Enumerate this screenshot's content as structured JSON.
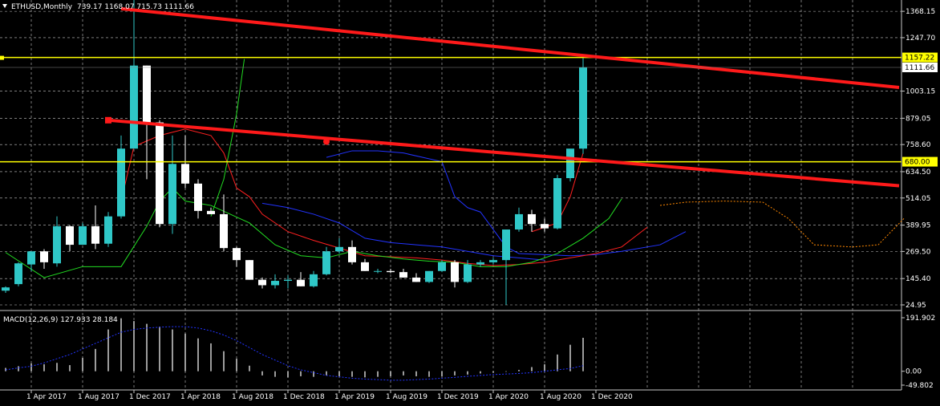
{
  "header": {
    "icon": "triangle-down-icon",
    "symbol_label": "ETHUSD,Monthly",
    "ohlc": "739.17 1168.07 715.73 1111.66"
  },
  "macd": {
    "label": "MACD(12,26,9) 127.933 28.184",
    "axis_labels": [
      "191.902",
      "0.00",
      "-49.802"
    ]
  },
  "colors": {
    "background": "#000000",
    "grid": "#c8c8c8",
    "bull_candle": "#2fc7c7",
    "bear_candle": "#ffffff",
    "trendline": "#ff1a1a",
    "level_line": "#ffff00",
    "ma_green": "#22dd22",
    "ma_red": "#ff2020",
    "ma_blue": "#2233ff",
    "forecast": "#ff8800"
  },
  "chart_data": {
    "type": "candlestick",
    "title": "ETHUSD,Monthly",
    "y_ticks": [
      "1368.15",
      "1247.70",
      "1003.15",
      "879.05",
      "758.60",
      "634.50",
      "514.05",
      "389.95",
      "269.50",
      "145.40",
      "24.95"
    ],
    "x_ticks": [
      "1 Apr 2017",
      "1 Aug 2017",
      "1 Dec 2017",
      "1 Apr 2018",
      "1 Aug 2018",
      "1 Dec 2018",
      "1 Apr 2019",
      "1 Aug 2019",
      "1 Dec 2019",
      "1 Apr 2020",
      "1 Aug 2020",
      "1 Dec 2020"
    ],
    "ylim": [
      24.95,
      1420
    ],
    "start_month": "Feb 2017",
    "candles": [
      {
        "o": 90,
        "h": 110,
        "l": 80,
        "c": 105
      },
      {
        "o": 120,
        "h": 220,
        "l": 110,
        "c": 215
      },
      {
        "o": 210,
        "h": 260,
        "l": 180,
        "c": 270
      },
      {
        "o": 270,
        "h": 280,
        "l": 190,
        "c": 220
      },
      {
        "o": 215,
        "h": 430,
        "l": 200,
        "c": 385
      },
      {
        "o": 385,
        "h": 390,
        "l": 270,
        "c": 300
      },
      {
        "o": 300,
        "h": 400,
        "l": 300,
        "c": 385
      },
      {
        "o": 385,
        "h": 480,
        "l": 280,
        "c": 305
      },
      {
        "o": 305,
        "h": 450,
        "l": 290,
        "c": 430
      },
      {
        "o": 430,
        "h": 800,
        "l": 420,
        "c": 740
      },
      {
        "o": 740,
        "h": 1420,
        "l": 740,
        "c": 1120
      },
      {
        "o": 1120,
        "h": 1120,
        "l": 600,
        "c": 860
      },
      {
        "o": 860,
        "h": 870,
        "l": 380,
        "c": 395
      },
      {
        "o": 395,
        "h": 800,
        "l": 350,
        "c": 670
      },
      {
        "o": 670,
        "h": 800,
        "l": 560,
        "c": 580
      },
      {
        "o": 580,
        "h": 600,
        "l": 420,
        "c": 455
      },
      {
        "o": 455,
        "h": 470,
        "l": 440,
        "c": 440
      },
      {
        "o": 440,
        "h": 530,
        "l": 270,
        "c": 285
      },
      {
        "o": 285,
        "h": 290,
        "l": 200,
        "c": 230
      },
      {
        "o": 230,
        "h": 230,
        "l": 140,
        "c": 140
      },
      {
        "o": 140,
        "h": 150,
        "l": 100,
        "c": 115
      },
      {
        "o": 115,
        "h": 165,
        "l": 100,
        "c": 135
      },
      {
        "o": 135,
        "h": 160,
        "l": 100,
        "c": 140
      },
      {
        "o": 140,
        "h": 175,
        "l": 110,
        "c": 110
      },
      {
        "o": 110,
        "h": 180,
        "l": 105,
        "c": 165
      },
      {
        "o": 165,
        "h": 290,
        "l": 160,
        "c": 270
      },
      {
        "o": 270,
        "h": 330,
        "l": 260,
        "c": 290
      },
      {
        "o": 290,
        "h": 320,
        "l": 210,
        "c": 220
      },
      {
        "o": 220,
        "h": 235,
        "l": 180,
        "c": 180
      },
      {
        "o": 180,
        "h": 190,
        "l": 170,
        "c": 180
      },
      {
        "o": 180,
        "h": 190,
        "l": 170,
        "c": 175
      },
      {
        "o": 175,
        "h": 190,
        "l": 150,
        "c": 150
      },
      {
        "o": 150,
        "h": 170,
        "l": 130,
        "c": 130
      },
      {
        "o": 130,
        "h": 180,
        "l": 125,
        "c": 180
      },
      {
        "o": 180,
        "h": 230,
        "l": 175,
        "c": 220
      },
      {
        "o": 220,
        "h": 230,
        "l": 105,
        "c": 130
      },
      {
        "o": 130,
        "h": 230,
        "l": 125,
        "c": 210
      },
      {
        "o": 210,
        "h": 230,
        "l": 200,
        "c": 220
      },
      {
        "o": 220,
        "h": 240,
        "l": 210,
        "c": 230
      },
      {
        "o": 230,
        "h": 360,
        "l": 25,
        "c": 370
      },
      {
        "o": 370,
        "h": 470,
        "l": 360,
        "c": 440
      },
      {
        "o": 440,
        "h": 460,
        "l": 360,
        "c": 395
      },
      {
        "o": 395,
        "h": 420,
        "l": 360,
        "c": 375
      },
      {
        "o": 375,
        "h": 620,
        "l": 370,
        "c": 605
      },
      {
        "o": 605,
        "h": 720,
        "l": 590,
        "c": 740
      },
      {
        "o": 740,
        "h": 1168,
        "l": 716,
        "c": 1112
      }
    ],
    "levels": [
      {
        "price": 1157.22,
        "label": "1157.22"
      },
      {
        "price": 680.0,
        "label": "680.00"
      }
    ],
    "last_price": {
      "price": 1111.66,
      "label": "1111.66"
    },
    "trendlines": [
      {
        "m1": 9,
        "p1": 1380,
        "m2": 70,
        "p2": 1020
      },
      {
        "m1": 8,
        "p1": 870,
        "m2": 70,
        "p2": 570
      }
    ],
    "ma_green": [
      [
        0,
        265
      ],
      [
        3,
        150
      ],
      [
        6,
        200
      ],
      [
        9,
        200
      ],
      [
        11,
        385
      ],
      [
        12,
        500
      ],
      [
        13,
        560
      ],
      [
        14,
        500
      ],
      [
        16,
        480
      ],
      [
        19,
        400
      ],
      [
        21,
        300
      ],
      [
        23,
        250
      ],
      [
        25,
        240
      ],
      [
        27,
        270
      ],
      [
        29,
        250
      ],
      [
        31,
        235
      ],
      [
        33,
        225
      ],
      [
        35,
        220
      ],
      [
        37,
        200
      ],
      [
        39,
        200
      ],
      [
        41,
        220
      ],
      [
        43,
        260
      ],
      [
        45,
        330
      ],
      [
        47,
        420
      ],
      [
        48,
        510
      ]
    ],
    "ma_red": [
      [
        9,
        500
      ],
      [
        10,
        750
      ],
      [
        12,
        800
      ],
      [
        14,
        830
      ],
      [
        16,
        800
      ],
      [
        17,
        720
      ],
      [
        18,
        560
      ],
      [
        19,
        520
      ],
      [
        20,
        440
      ],
      [
        22,
        360
      ],
      [
        24,
        320
      ],
      [
        26,
        285
      ],
      [
        28,
        250
      ],
      [
        30,
        245
      ],
      [
        32,
        240
      ],
      [
        34,
        230
      ],
      [
        36,
        215
      ],
      [
        38,
        205
      ],
      [
        40,
        210
      ],
      [
        42,
        220
      ],
      [
        44,
        240
      ],
      [
        46,
        260
      ],
      [
        48,
        290
      ],
      [
        50,
        380
      ]
    ],
    "ma_red_recent": [
      [
        41,
        360
      ],
      [
        43,
        400
      ],
      [
        44,
        520
      ],
      [
        45,
        720
      ]
    ],
    "ma_green_recent": [
      [
        16,
        430
      ],
      [
        17,
        600
      ],
      [
        18,
        900
      ],
      [
        18.6,
        1150
      ]
    ],
    "ma_blue": [
      [
        25,
        700
      ],
      [
        27,
        730
      ],
      [
        29,
        730
      ],
      [
        31,
        720
      ],
      [
        34,
        680
      ],
      [
        35,
        520
      ],
      [
        36,
        470
      ],
      [
        37,
        450
      ],
      [
        39,
        290
      ],
      [
        40,
        260
      ],
      [
        42,
        255
      ],
      [
        44,
        250
      ],
      [
        46,
        255
      ],
      [
        48,
        270
      ],
      [
        51,
        300
      ],
      [
        53,
        360
      ]
    ],
    "ma_blue_early": [
      [
        20,
        490
      ],
      [
        22,
        470
      ],
      [
        24,
        440
      ],
      [
        26,
        400
      ],
      [
        28,
        330
      ],
      [
        30,
        310
      ],
      [
        32,
        300
      ],
      [
        34,
        290
      ],
      [
        36,
        270
      ],
      [
        38,
        250
      ],
      [
        40,
        240
      ],
      [
        42,
        230
      ]
    ],
    "forecast": [
      [
        51,
        480
      ],
      [
        53,
        495
      ],
      [
        56,
        500
      ],
      [
        59,
        495
      ],
      [
        61,
        420
      ],
      [
        63,
        300
      ],
      [
        66,
        290
      ],
      [
        68,
        300
      ],
      [
        70,
        420
      ]
    ],
    "macd_hist": [
      12,
      18,
      28,
      25,
      30,
      22,
      48,
      80,
      150,
      190,
      180,
      170,
      160,
      150,
      135,
      118,
      100,
      72,
      45,
      20,
      -15,
      -20,
      -22,
      -18,
      -20,
      -15,
      -18,
      -20,
      -22,
      -20,
      -18,
      -15,
      -18,
      -20,
      -18,
      -15,
      -12,
      -8,
      -5,
      -2,
      5,
      15,
      25,
      60,
      95,
      120
    ],
    "macd_signal": [
      5,
      12,
      18,
      30,
      45,
      60,
      80,
      100,
      120,
      140,
      150,
      155,
      158,
      160,
      160,
      155,
      145,
      130,
      110,
      85,
      60,
      40,
      20,
      5,
      -5,
      -15,
      -20,
      -25,
      -28,
      -30,
      -32,
      -32,
      -30,
      -28,
      -25,
      -22,
      -18,
      -15,
      -12,
      -10,
      -8,
      -5,
      0,
      5,
      10,
      20
    ]
  }
}
